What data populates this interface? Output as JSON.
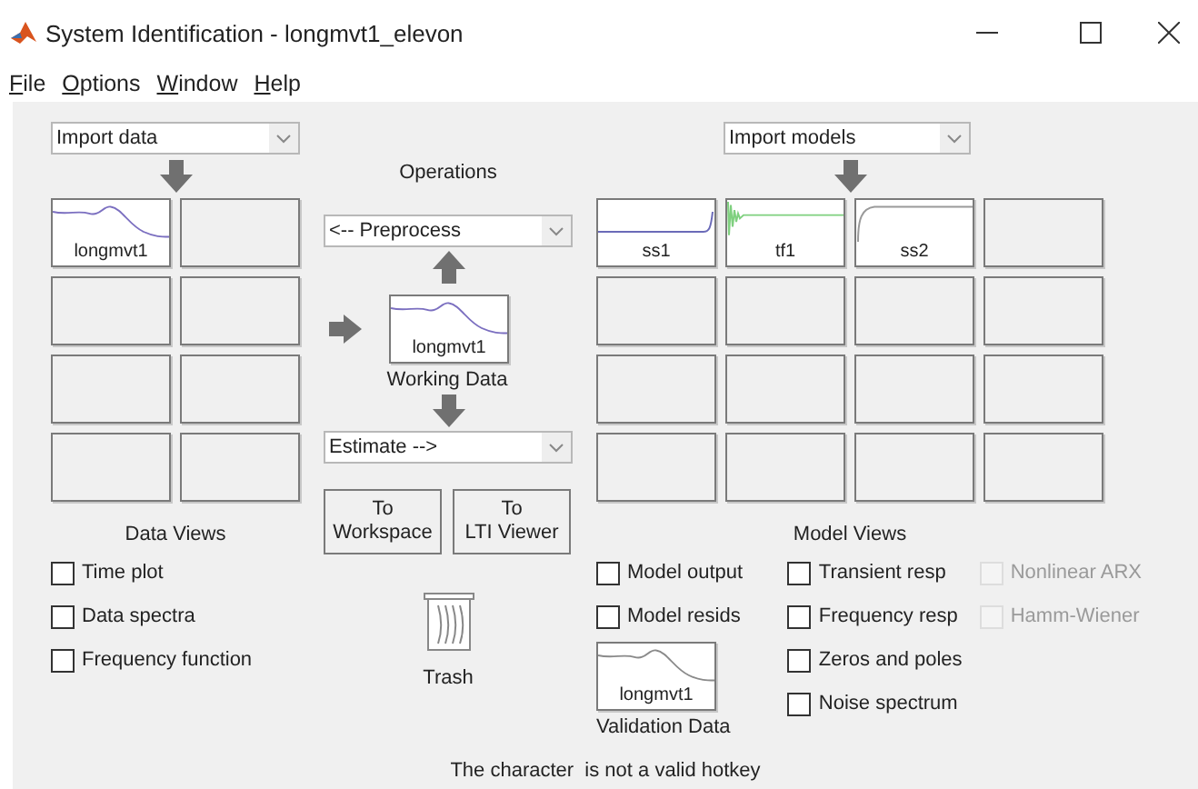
{
  "window": {
    "title": "System Identification - longmvt1_elevon"
  },
  "menu": [
    {
      "hotkey": "F",
      "rest": "ile"
    },
    {
      "hotkey": "O",
      "rest": "ptions"
    },
    {
      "hotkey": "W",
      "rest": "indow"
    },
    {
      "hotkey": "H",
      "rest": "elp"
    }
  ],
  "data_panel": {
    "import_dropdown": "Import data",
    "tiles": [
      {
        "kind": "data",
        "label": "longmvt1",
        "color": "#7b6fc0"
      },
      {
        "kind": "empty"
      },
      {
        "kind": "empty"
      },
      {
        "kind": "empty"
      },
      {
        "kind": "empty"
      },
      {
        "kind": "empty"
      },
      {
        "kind": "empty"
      },
      {
        "kind": "empty"
      }
    ],
    "views_title": "Data Views",
    "views": [
      {
        "label": "Time plot",
        "checked": false,
        "disabled": false
      },
      {
        "label": "Data spectra",
        "checked": false,
        "disabled": false
      },
      {
        "label": "Frequency function",
        "checked": false,
        "disabled": false
      }
    ]
  },
  "operations": {
    "title": "Operations",
    "preprocess_dropdown": "<-- Preprocess",
    "working_data": {
      "kind": "data",
      "label": "longmvt1",
      "color": "#7b6fc0"
    },
    "working_label": "Working Data",
    "estimate_dropdown": "Estimate -->",
    "buttons": [
      {
        "line1": "To",
        "line2": "Workspace"
      },
      {
        "line1": "To",
        "line2": "LTI Viewer"
      }
    ],
    "trash_label": "Trash"
  },
  "model_panel": {
    "import_dropdown": "Import models",
    "tiles": [
      {
        "kind": "step",
        "label": "ss1",
        "color": "#6a6ab8"
      },
      {
        "kind": "oscillation",
        "label": "tf1",
        "color": "#7fd07f"
      },
      {
        "kind": "rise",
        "label": "ss2",
        "color": "#9a9a9a"
      },
      {
        "kind": "empty"
      },
      {
        "kind": "empty"
      },
      {
        "kind": "empty"
      },
      {
        "kind": "empty"
      },
      {
        "kind": "empty"
      },
      {
        "kind": "empty"
      },
      {
        "kind": "empty"
      },
      {
        "kind": "empty"
      },
      {
        "kind": "empty"
      },
      {
        "kind": "empty"
      },
      {
        "kind": "empty"
      },
      {
        "kind": "empty"
      },
      {
        "kind": "empty"
      }
    ],
    "views_title": "Model Views",
    "view_columns": [
      [
        {
          "label": "Model output",
          "checked": false,
          "disabled": false
        },
        {
          "label": "Model resids",
          "checked": false,
          "disabled": false
        }
      ],
      [
        {
          "label": "Transient resp",
          "checked": false,
          "disabled": false
        },
        {
          "label": "Frequency resp",
          "checked": false,
          "disabled": false
        },
        {
          "label": "Zeros and poles",
          "checked": false,
          "disabled": false
        },
        {
          "label": "Noise spectrum",
          "checked": false,
          "disabled": false
        }
      ],
      [
        {
          "label": "Nonlinear ARX",
          "checked": false,
          "disabled": true
        },
        {
          "label": "Hamm-Wiener",
          "checked": false,
          "disabled": true
        }
      ]
    ],
    "validation_data": {
      "kind": "data",
      "label": "longmvt1",
      "color": "#8a8a8a"
    },
    "validation_label": "Validation Data"
  },
  "status_bar": "The character  is not a valid hotkey"
}
